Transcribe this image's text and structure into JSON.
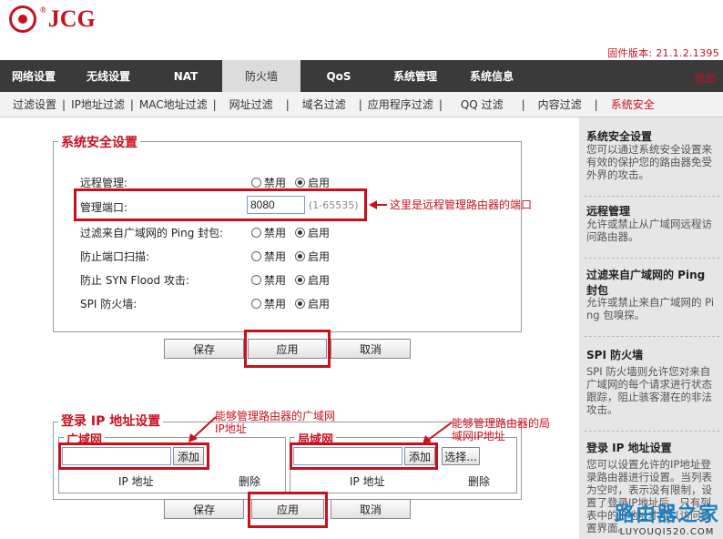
{
  "brand": {
    "logo_text": "JCG",
    "logo_reg": "®"
  },
  "firmware": "固件版本: 21.1.2.1395",
  "menu": {
    "items": [
      "网络设置",
      "无线设置",
      "NAT",
      "防火墙",
      "QoS",
      "系统管理",
      "系统信息"
    ],
    "active": "防火墙",
    "exit": "退出"
  },
  "submenu": {
    "items": [
      "过滤设置",
      "IP地址过滤",
      "MAC地址过滤",
      "网址过滤",
      "域名过滤",
      "应用程序过滤",
      "QQ 过滤",
      "内容过滤",
      "系统安全"
    ],
    "active": "系统安全"
  },
  "security": {
    "legend": "系统安全设置",
    "remote_mgmt_label": "远程管理:",
    "port_label": "管理端口:",
    "port_value": "8080",
    "port_range": "(1-65535)",
    "ping_label": "过滤来自广域网的  Ping 封包:",
    "scan_label": "防止端口扫描:",
    "synflood_label": "防止  SYN Flood 攻击:",
    "spi_label": "SPI 防火墙:",
    "disable": "禁用",
    "enable": "启用",
    "annotation": "这里是远程管理路由器的端口"
  },
  "buttons": {
    "save": "保存",
    "apply": "应用",
    "cancel": "取消"
  },
  "login": {
    "legend": "登录  IP 地址设置",
    "wan": {
      "legend": "广域网",
      "add": "添加",
      "ip_header": "IP 地址",
      "del_header": "删除",
      "annotation_1": "能够管理路由器的广域网",
      "annotation_2": "IP地址"
    },
    "lan": {
      "legend": "局域网",
      "add": "添加",
      "select": "选择...",
      "ip_header": "IP 地址",
      "del_header": "删除",
      "annotation_1": "能够管理路由器的局",
      "annotation_2": "域网IP地址"
    }
  },
  "help": [
    {
      "title": "系统安全设置",
      "text": "您可以通过系统安全设置来有效的保护您的路由器免受外界的攻击。"
    },
    {
      "title": "远程管理",
      "text": "允许或禁止从广域网远程访问路由器。"
    },
    {
      "title": "过滤来自广域网的  Ping 封包",
      "text": "允许或禁止来自广域网的 Ping 包嗅探。"
    },
    {
      "title": "SPI 防火墙",
      "text": "SPI 防火墙则允许您对来自广域网的每个请求进行状态跟踪，阻止骇客潜在的非法攻击。"
    },
    {
      "title": "登录  IP 地址设置",
      "text": "您可以设置允许的IP地址登录路由器进行设置。当列表为空时，表示没有限制，设置了登录IP地址后，只有列表中的IP地址才可以访问设置界面。"
    }
  ],
  "watermark": {
    "line1": "路由器之家",
    "line2": "LUYOUQI520.COM"
  }
}
